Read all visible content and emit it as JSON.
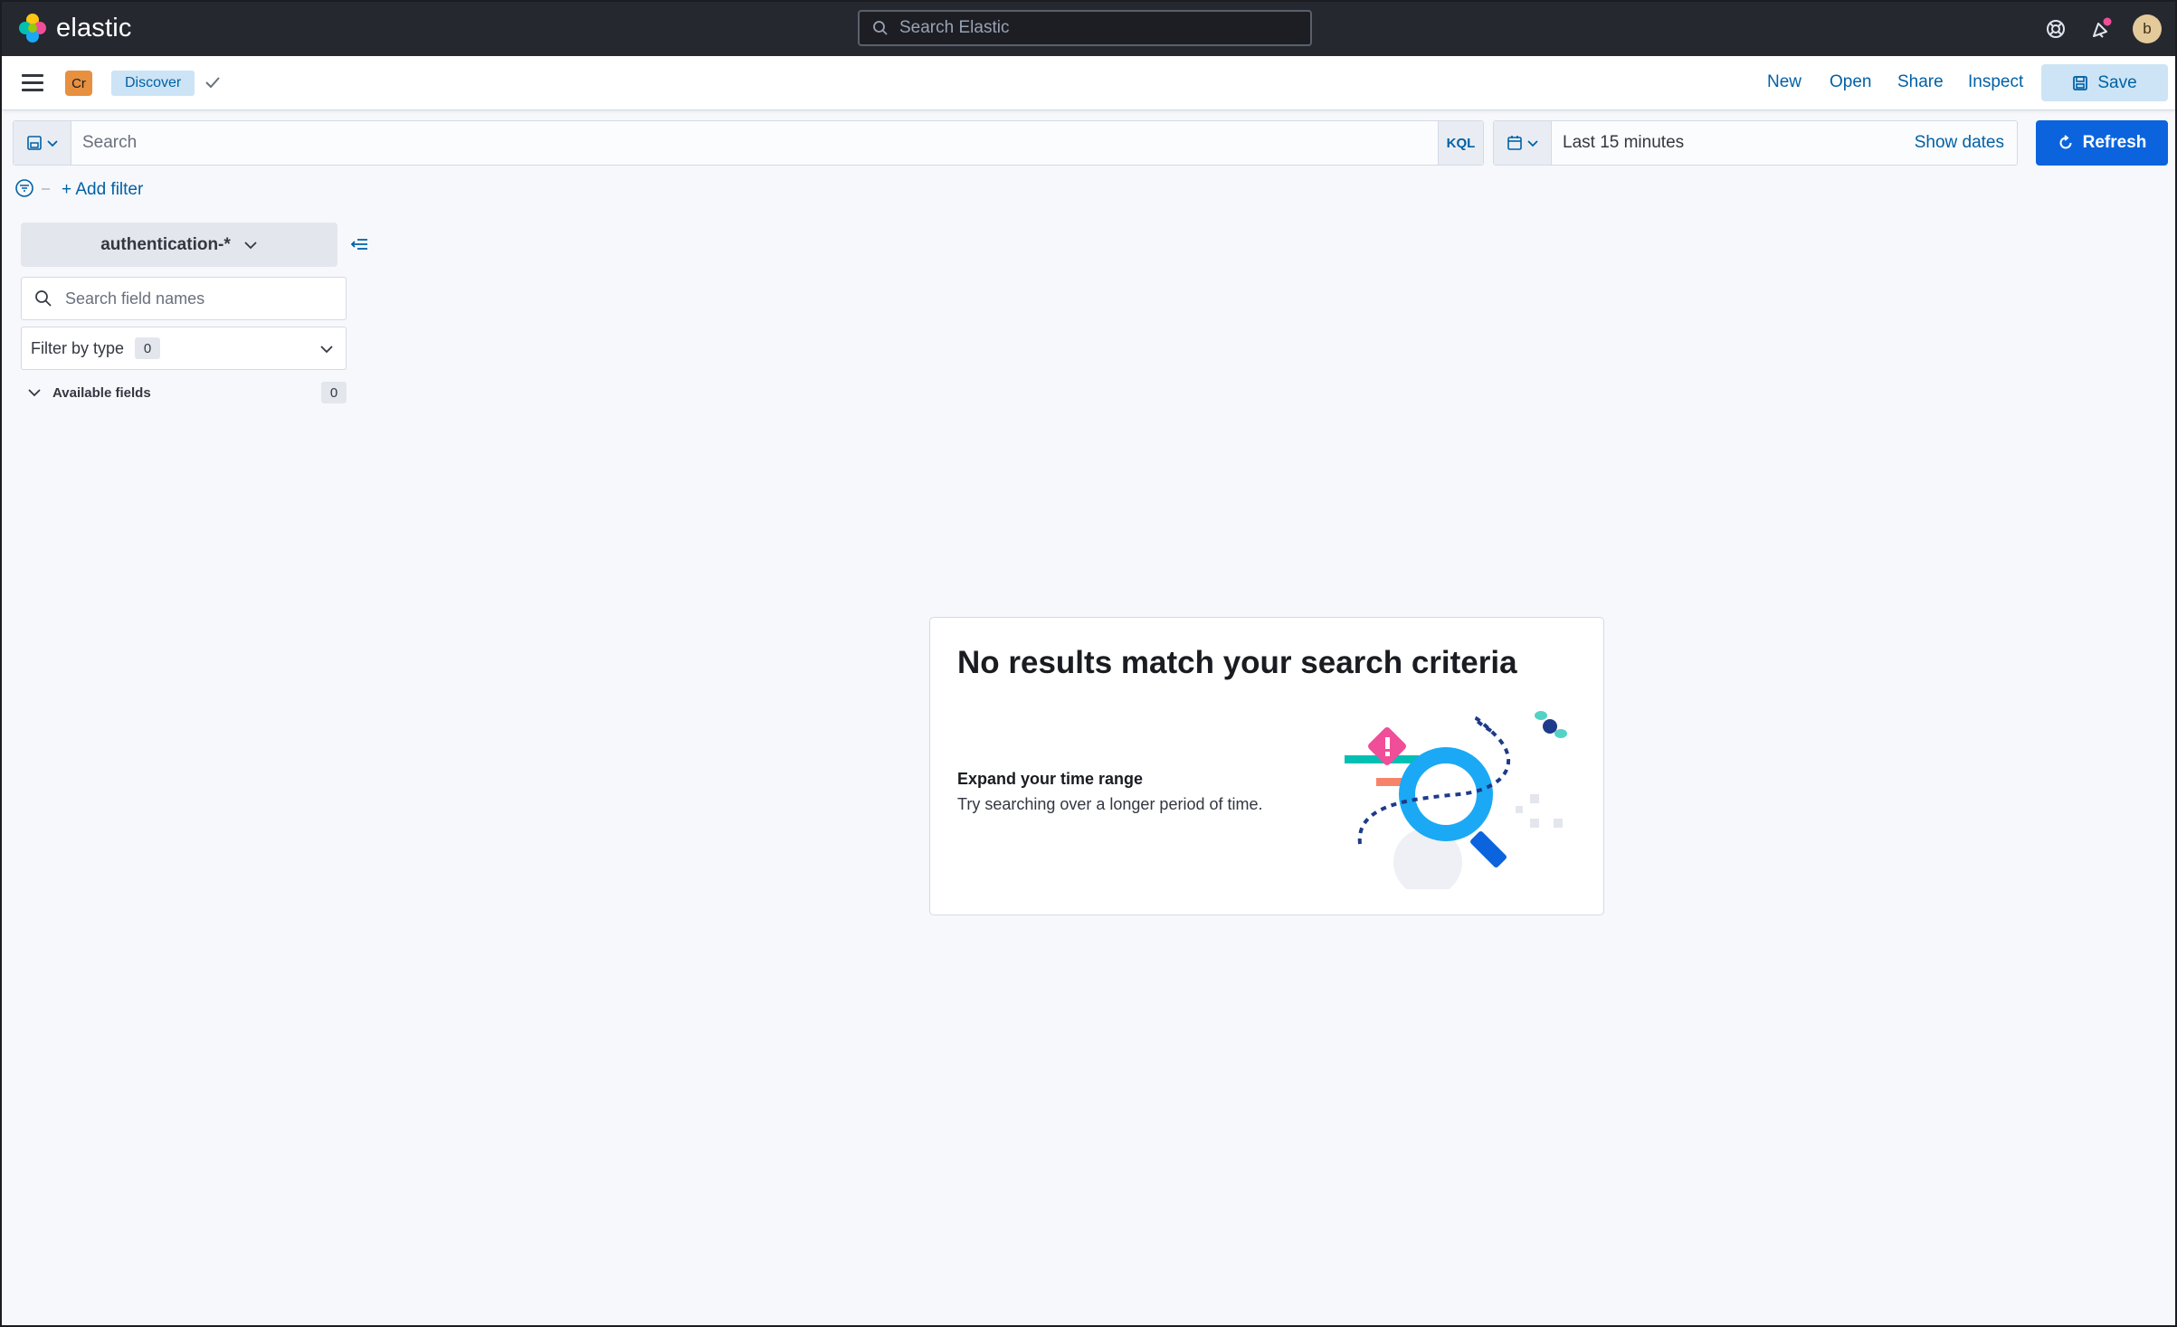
{
  "header": {
    "brand": "elastic",
    "search_placeholder": "Search Elastic",
    "user_initial": "b"
  },
  "subheader": {
    "space_initials": "Cr",
    "breadcrumb": "Discover",
    "menu": {
      "new": "New",
      "open": "Open",
      "share": "Share",
      "inspect": "Inspect",
      "save": "Save"
    }
  },
  "query": {
    "placeholder": "Search",
    "language": "KQL",
    "time_range": "Last 15 minutes",
    "show_dates": "Show dates",
    "refresh": "Refresh",
    "add_filter": "+ Add filter"
  },
  "sidebar": {
    "index_pattern": "authentication-*",
    "field_search_placeholder": "Search field names",
    "filter_by_type": "Filter by type",
    "filter_count": "0",
    "available_fields_label": "Available fields",
    "available_fields_count": "0"
  },
  "empty_state": {
    "title": "No results match your search criteria",
    "subtitle": "Expand your time range",
    "description": "Try searching over a longer period of time."
  },
  "colors": {
    "header_bg": "#25282f",
    "link": "#0061a6",
    "primary_button": "#0b64dd",
    "accent_orange": "#e7903f"
  },
  "icons": [
    "elastic-logo-icon",
    "search-icon",
    "help-icon",
    "news-feed-icon",
    "menu-icon",
    "checkmark-icon",
    "save-icon",
    "saved-query-icon",
    "chevron-down-icon",
    "calendar-icon",
    "refresh-icon",
    "filter-icon",
    "collapse-sidebar-icon",
    "no-results-illustration"
  ]
}
